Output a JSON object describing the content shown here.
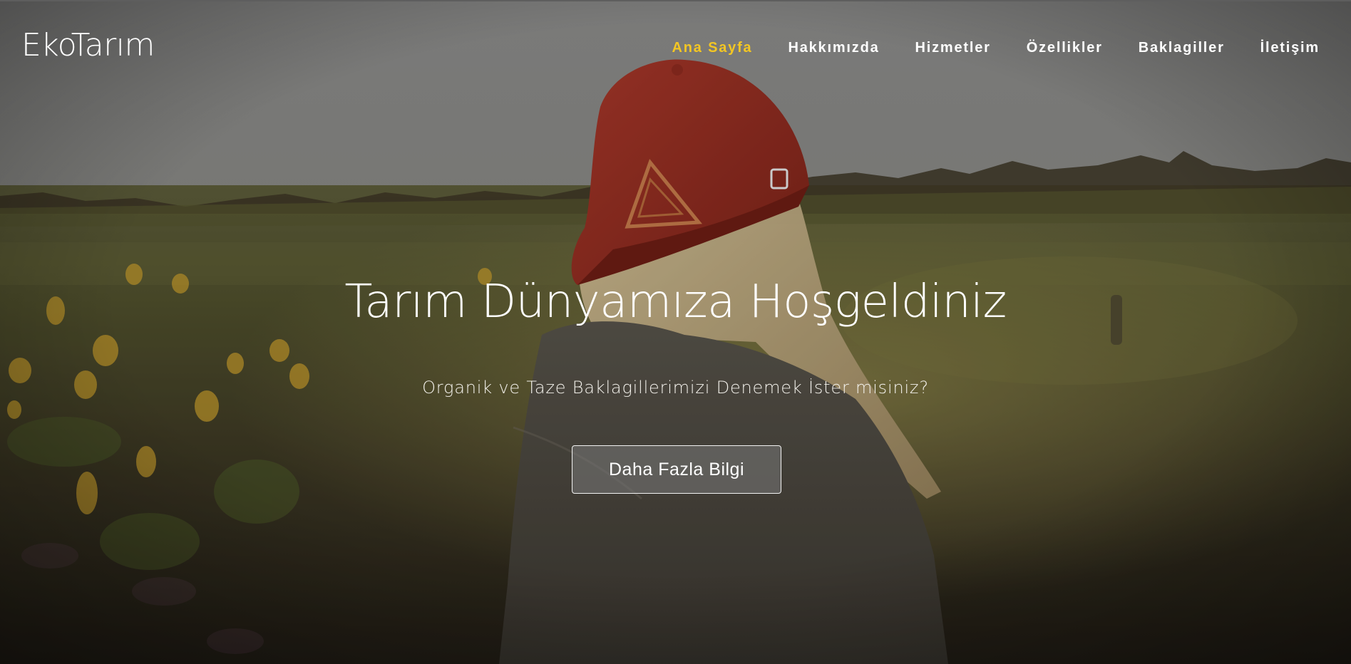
{
  "brand": {
    "name": "EkoTarım"
  },
  "nav": {
    "items": [
      {
        "label": "Ana Sayfa",
        "active": true
      },
      {
        "label": "Hakkımızda",
        "active": false
      },
      {
        "label": "Hizmetler",
        "active": false
      },
      {
        "label": "Özellikler",
        "active": false
      },
      {
        "label": "Baklagiller",
        "active": false
      },
      {
        "label": "İletişim",
        "active": false
      }
    ]
  },
  "hero": {
    "title": "Tarım Dünyamıza Hoşgeldiniz",
    "subtitle": "Organik ve Taze Baklagillerimizi Denemek İster misiniz?",
    "cta_label": "Daha Fazla Bilgi",
    "background_image": "woman-red-cap-field-photo"
  },
  "colors": {
    "accent": "#f3c623",
    "text": "#ffffff",
    "sky": "#8a8a88"
  }
}
